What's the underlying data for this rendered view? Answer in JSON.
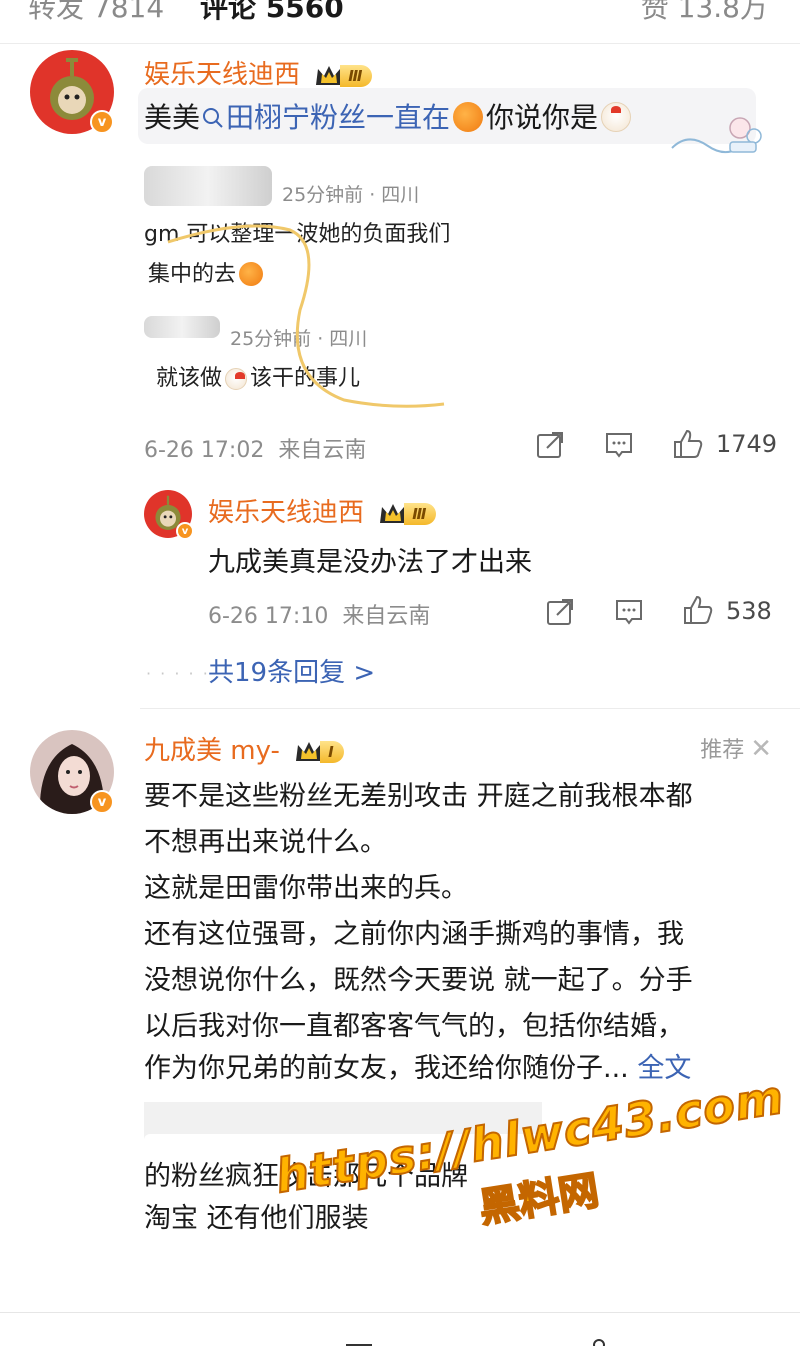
{
  "tabs": {
    "reposts": "转发 7814",
    "comments": "评论 5560",
    "likes": "赞 13.8万"
  },
  "comment1": {
    "username": "娱乐天线迪西",
    "level": "Ⅲ",
    "text_prefix": "美美",
    "topic": "田栩宁粉丝一直在",
    "text_mid": "你说你是",
    "embedded": {
      "meta1": "25分钟前 · 四川",
      "line1": "gm 可以整理一波她的负面我们",
      "line2": "集中的去",
      "meta2": "25分钟前 · 四川",
      "line3": "就该做",
      "line3b": "该干的事儿"
    },
    "time": "6-26 17:02",
    "source": "来自云南",
    "likes": "1749"
  },
  "reply1": {
    "username": "娱乐天线迪西",
    "level": "Ⅲ",
    "text": "九成美真是没办法了才出来",
    "time": "6-26 17:10",
    "source": "来自云南",
    "likes": "538",
    "more": "共19条回复 >"
  },
  "comment2": {
    "username": "九成美 my-",
    "level": "Ⅰ",
    "recommend": "推荐",
    "lines": [
      "要不是这些粉丝无差别攻击 开庭之前我根本都",
      "不想再出来说什么。",
      "这就是田雷你带出来的兵。",
      "还有这位强哥，之前你内涵手撕鸡的事情，我",
      "没想说你什么，既然今天要说 就一起了。分手",
      "以后我对你一直都客客气气的，包括你结婚，",
      "作为你兄弟的前女友，我还给你随份子..."
    ],
    "full_text": "全文",
    "shot_lines": [
      "的粉丝疯狂攻击那几个品牌",
      "淘宝 还有他们服装"
    ]
  },
  "watermark": {
    "url": "https://hlwc43.com",
    "name": "黑料网"
  },
  "colors": {
    "username": "#e86b1f",
    "link": "#3c64b4",
    "watermark": "#ffb300"
  }
}
